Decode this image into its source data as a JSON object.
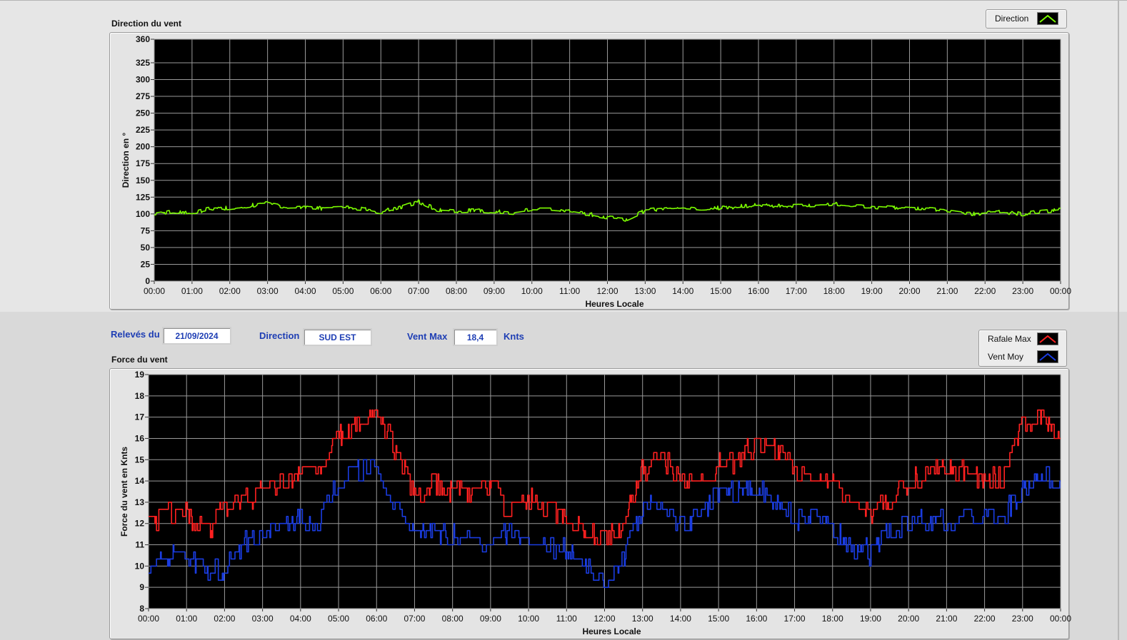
{
  "direction_panel": {
    "title": "Direction du vent",
    "legend": [
      {
        "label": "Direction",
        "color": "#7cfc00"
      }
    ]
  },
  "info_bar": {
    "releves_label": "Relevés du",
    "date": "21/09/2024",
    "direction_label": "Direction",
    "direction_value": "SUD EST",
    "ventmax_label": "Vent Max",
    "ventmax_value": "18,4",
    "unit": "Knts"
  },
  "force_panel": {
    "title": "Force du vent",
    "legend": [
      {
        "label": "Rafale Max",
        "color": "#ff2020"
      },
      {
        "label": "Vent Moy",
        "color": "#1a3ce0"
      }
    ]
  },
  "chart_data": [
    {
      "type": "line",
      "xlabel": "Heures Locale",
      "ylabel": "Direction en °",
      "ylim": [
        0,
        360
      ],
      "yticks": [
        "0",
        "25",
        "50",
        "75",
        "100",
        "125",
        "150",
        "175",
        "200",
        "225",
        "250",
        "275",
        "300",
        "325",
        "360"
      ],
      "xticks": [
        "00:00",
        "01:00",
        "02:00",
        "03:00",
        "04:00",
        "05:00",
        "06:00",
        "07:00",
        "08:00",
        "09:00",
        "10:00",
        "11:00",
        "12:00",
        "13:00",
        "14:00",
        "15:00",
        "16:00",
        "17:00",
        "18:00",
        "19:00",
        "20:00",
        "21:00",
        "22:00",
        "23:00",
        "00:00"
      ],
      "background": "#000000",
      "grid": true,
      "series": [
        {
          "name": "Direction",
          "color": "#7cfc00",
          "x": [
            0,
            0.5,
            1,
            1.5,
            2,
            2.5,
            3,
            3.5,
            4,
            4.5,
            5,
            5.5,
            6,
            6.5,
            7,
            7.5,
            8,
            8.5,
            9,
            9.5,
            10,
            10.5,
            11,
            11.5,
            12,
            12.5,
            13,
            13.5,
            14,
            14.5,
            15,
            15.5,
            16,
            16.5,
            17,
            17.5,
            18,
            18.5,
            19,
            19.5,
            20,
            20.5,
            21,
            21.5,
            22,
            22.5,
            23,
            23.5,
            24
          ],
          "values": [
            100,
            104,
            101,
            108,
            109,
            112,
            116,
            110,
            111,
            108,
            109,
            108,
            103,
            110,
            118,
            106,
            104,
            105,
            104,
            102,
            106,
            106,
            104,
            100,
            95,
            92,
            105,
            108,
            110,
            108,
            109,
            111,
            113,
            112,
            112,
            113,
            115,
            112,
            111,
            109,
            108,
            107,
            104,
            100,
            101,
            103,
            100,
            104,
            106
          ]
        }
      ]
    },
    {
      "type": "line",
      "xlabel": "Heures Locale",
      "ylabel": "Force du vent en Knts",
      "ylim": [
        8,
        19
      ],
      "yticks": [
        "8",
        "9",
        "10",
        "11",
        "12",
        "13",
        "14",
        "15",
        "16",
        "17",
        "18",
        "19"
      ],
      "xticks": [
        "00:00",
        "01:00",
        "02:00",
        "03:00",
        "04:00",
        "05:00",
        "06:00",
        "07:00",
        "08:00",
        "09:00",
        "10:00",
        "11:00",
        "12:00",
        "13:00",
        "14:00",
        "15:00",
        "16:00",
        "17:00",
        "18:00",
        "19:00",
        "20:00",
        "21:00",
        "22:00",
        "23:00",
        "00:00"
      ],
      "background": "#000000",
      "grid": true,
      "series": [
        {
          "name": "Rafale Max",
          "color": "#ff2020",
          "x": [
            0,
            0.5,
            1,
            1.5,
            2,
            2.5,
            3,
            3.5,
            4,
            4.5,
            5,
            5.5,
            6,
            6.5,
            7,
            7.5,
            8,
            8.5,
            9,
            9.5,
            10,
            10.5,
            11,
            11.5,
            12,
            12.5,
            13,
            13.5,
            14,
            14.5,
            15,
            15.5,
            16,
            16.5,
            17,
            17.5,
            18,
            18.5,
            19,
            19.5,
            20,
            20.5,
            21,
            21.5,
            22,
            22.5,
            23,
            23.5,
            24
          ],
          "values": [
            11.8,
            12.3,
            12.5,
            11.5,
            12.6,
            13.2,
            13.5,
            13.8,
            14.8,
            14.5,
            16.2,
            16.6,
            17.5,
            15.5,
            13.2,
            13.8,
            13.3,
            13.6,
            13.8,
            12.6,
            13.1,
            12.7,
            12.4,
            11.6,
            11.5,
            11.7,
            14.5,
            15.3,
            14.0,
            14.2,
            14.7,
            14.9,
            15.8,
            15.4,
            14.6,
            14.2,
            13.9,
            13.2,
            12.2,
            13.2,
            14.0,
            14.4,
            14.7,
            14.6,
            14.1,
            14.2,
            16.6,
            16.8,
            16.1
          ]
        },
        {
          "name": "Vent Moy",
          "color": "#1a3ce0",
          "x": [
            0,
            0.5,
            1,
            1.5,
            2,
            2.5,
            3,
            3.5,
            4,
            4.5,
            5,
            5.5,
            6,
            6.5,
            7,
            7.5,
            8,
            8.5,
            9,
            9.5,
            10,
            10.5,
            11,
            11.5,
            12,
            12.5,
            13,
            13.5,
            14,
            14.5,
            15,
            15.5,
            16,
            16.5,
            17,
            17.5,
            18,
            18.5,
            19,
            19.5,
            20,
            20.5,
            21,
            21.5,
            22,
            22.5,
            23,
            23.5,
            24
          ],
          "values": [
            10.1,
            10.3,
            10.5,
            9.6,
            10.0,
            11.0,
            11.5,
            11.5,
            12.5,
            12.0,
            14.0,
            14.3,
            14.8,
            12.6,
            11.6,
            11.6,
            11.4,
            11.1,
            11.1,
            11.6,
            11.1,
            10.9,
            10.6,
            10.1,
            9.5,
            10.2,
            12.7,
            13.3,
            12.0,
            12.3,
            13.4,
            13.5,
            13.8,
            13.0,
            12.3,
            12.3,
            11.9,
            10.8,
            10.6,
            11.8,
            12.2,
            12.0,
            12.1,
            12.4,
            12.4,
            12.3,
            13.6,
            14.1,
            14.2
          ]
        }
      ]
    }
  ]
}
